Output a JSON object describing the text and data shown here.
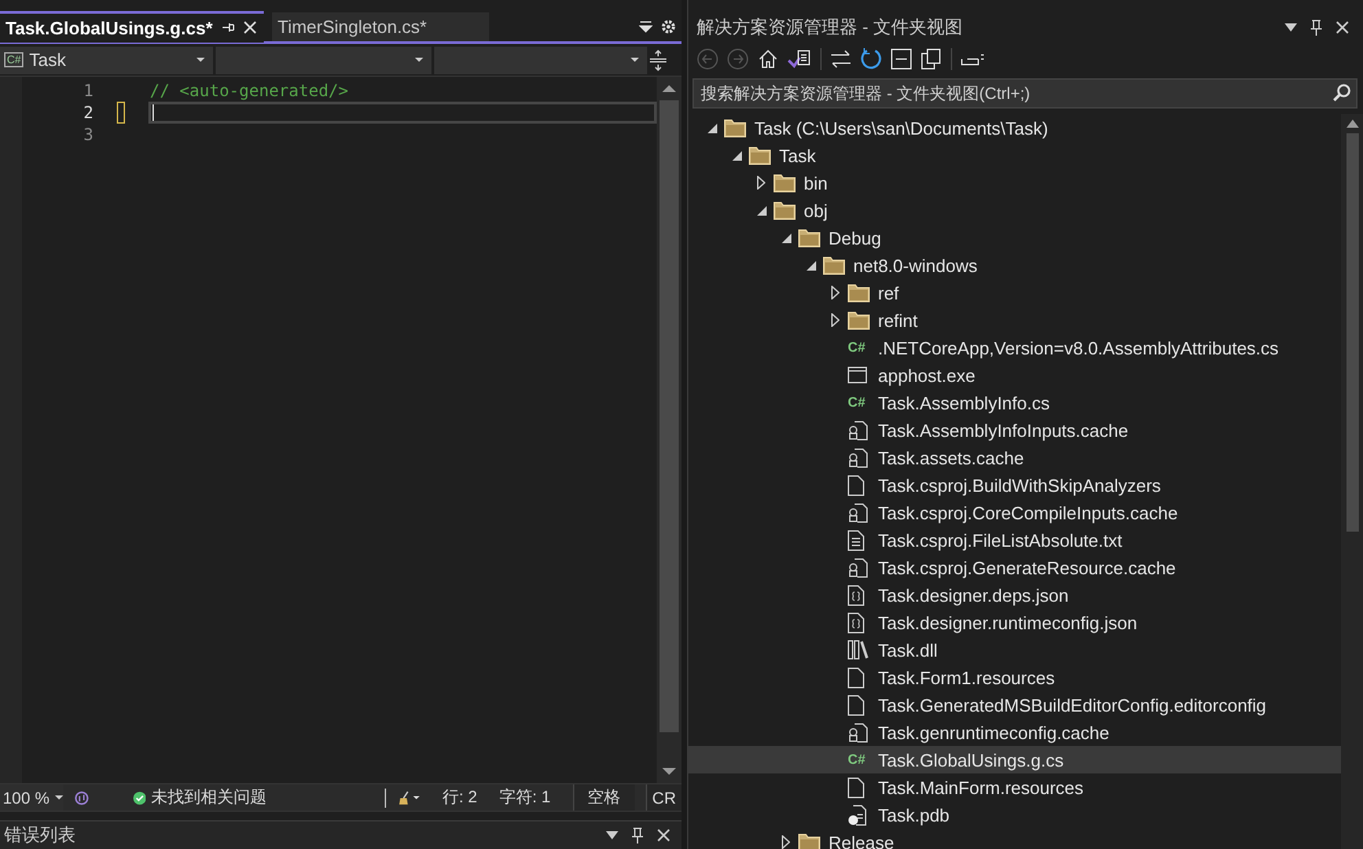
{
  "editor": {
    "tabs": [
      {
        "label": "Task.GlobalUsings.g.cs*",
        "selected": true
      },
      {
        "label": "TimerSingleton.cs*",
        "selected": false
      }
    ],
    "nav": {
      "badge": "C#",
      "project": "Task"
    },
    "lines": [
      {
        "number": "1",
        "code": "// <auto-generated/>",
        "current": false
      },
      {
        "number": "2",
        "current": true
      },
      {
        "number": "3",
        "current": false
      }
    ]
  },
  "status_bar": {
    "zoom": "100 %",
    "issues": "未找到相关问题",
    "line": "行: 2",
    "column": "字符: 1",
    "spaces": "空格",
    "line_ending": "CR"
  },
  "bottom_panel": {
    "title": "错误列表"
  },
  "explorer": {
    "title": "解决方案资源管理器 - 文件夹视图",
    "search": {
      "placeholder": "搜索解决方案资源管理器 - 文件夹视图(Ctrl+;)"
    },
    "tree": [
      {
        "label": "Task (C:\\Users\\san\\Documents\\Task)",
        "kind": "folder",
        "expanded": true,
        "selected": false,
        "children": [
          {
            "label": "Task",
            "kind": "folder",
            "expanded": true,
            "selected": false,
            "children": [
              {
                "label": "bin",
                "kind": "folder",
                "expanded": false,
                "selected": false
              },
              {
                "label": "obj",
                "kind": "folder",
                "expanded": true,
                "selected": false,
                "children": [
                  {
                    "label": "Debug",
                    "kind": "folder",
                    "expanded": true,
                    "selected": false,
                    "children": [
                      {
                        "label": "net8.0-windows",
                        "kind": "folder",
                        "expanded": true,
                        "selected": false,
                        "children": [
                          {
                            "label": "ref",
                            "kind": "folder",
                            "expanded": false,
                            "selected": false
                          },
                          {
                            "label": "refint",
                            "kind": "folder",
                            "expanded": false,
                            "selected": false
                          },
                          {
                            "label": ".NETCoreApp,Version=v8.0.AssemblyAttributes.cs",
                            "kind": "csharp",
                            "badge": "C#",
                            "selected": false
                          },
                          {
                            "label": "apphost.exe",
                            "kind": "exe",
                            "selected": false
                          },
                          {
                            "label": "Task.AssemblyInfo.cs",
                            "kind": "csharp",
                            "badge": "C#",
                            "selected": false
                          },
                          {
                            "label": "Task.AssemblyInfoInputs.cache",
                            "kind": "cache",
                            "selected": false
                          },
                          {
                            "label": "Task.assets.cache",
                            "kind": "cache",
                            "selected": false
                          },
                          {
                            "label": "Task.csproj.BuildWithSkipAnalyzers",
                            "kind": "file",
                            "selected": false
                          },
                          {
                            "label": "Task.csproj.CoreCompileInputs.cache",
                            "kind": "cache",
                            "selected": false
                          },
                          {
                            "label": "Task.csproj.FileListAbsolute.txt",
                            "kind": "text",
                            "selected": false
                          },
                          {
                            "label": "Task.csproj.GenerateResource.cache",
                            "kind": "cache",
                            "selected": false
                          },
                          {
                            "label": "Task.designer.deps.json",
                            "kind": "json",
                            "selected": false
                          },
                          {
                            "label": "Task.designer.runtimeconfig.json",
                            "kind": "json",
                            "selected": false
                          },
                          {
                            "label": "Task.dll",
                            "kind": "dll",
                            "selected": false
                          },
                          {
                            "label": "Task.Form1.resources",
                            "kind": "file",
                            "selected": false
                          },
                          {
                            "label": "Task.GeneratedMSBuildEditorConfig.editorconfig",
                            "kind": "file",
                            "selected": false
                          },
                          {
                            "label": "Task.genruntimeconfig.cache",
                            "kind": "cache",
                            "selected": false
                          },
                          {
                            "label": "Task.GlobalUsings.g.cs",
                            "kind": "csharp",
                            "badge": "C#",
                            "selected": true
                          },
                          {
                            "label": "Task.MainForm.resources",
                            "kind": "file",
                            "selected": false
                          },
                          {
                            "label": "Task.pdb",
                            "kind": "pdb",
                            "selected": false
                          }
                        ]
                      }
                    ]
                  },
                  {
                    "label": "Release",
                    "kind": "folder",
                    "expanded": false,
                    "selected": false
                  }
                ]
              }
            ]
          }
        ]
      }
    ]
  }
}
